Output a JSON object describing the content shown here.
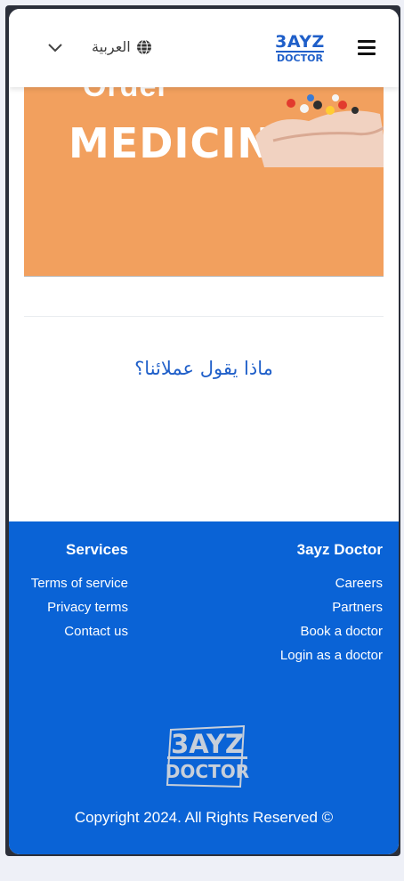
{
  "header": {
    "language_label": "العربية",
    "logo_line1": "3AYZ",
    "logo_line2": "DOCTOR",
    "icons": [
      "chevron-down-icon",
      "globe-icon",
      "hamburger-menu-icon"
    ]
  },
  "banner": {
    "partial_text": "Order",
    "title": "MEDICINE",
    "background": "#f2a05e"
  },
  "section": {
    "title": "ماذا يقول عملائنا؟"
  },
  "footer": {
    "background": "#0a63d6",
    "services": {
      "heading": "Services",
      "links": [
        "Terms of service",
        "Privacy terms",
        "Contact us"
      ]
    },
    "company": {
      "heading": "3ayz Doctor",
      "links": [
        "Careers",
        "Partners",
        "Book a doctor",
        "Login as a doctor"
      ]
    },
    "logo_line1": "3AYZ",
    "logo_line2": "DOCTOR",
    "copyright": "Copyright 2024. All Rights Reserved ©"
  }
}
